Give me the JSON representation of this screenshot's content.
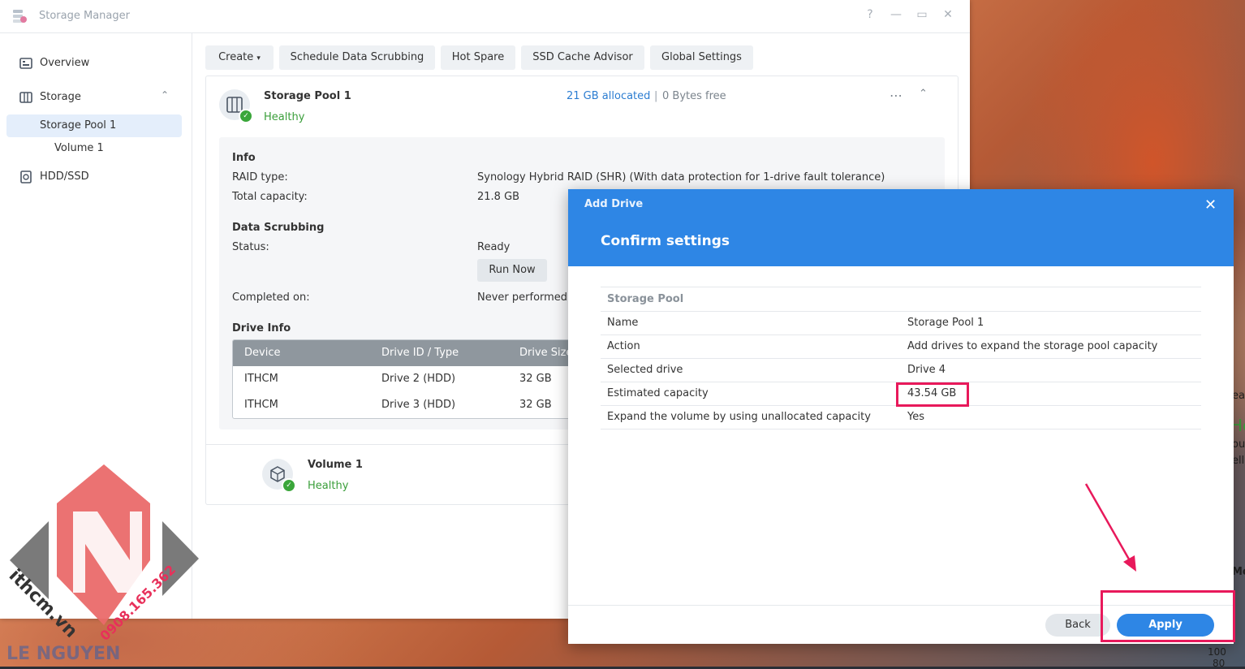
{
  "window": {
    "title": "Storage Manager",
    "controls": [
      "?",
      "—",
      "▭",
      "✕"
    ]
  },
  "sidebar": {
    "items": [
      {
        "label": "Overview",
        "icon": "overview-icon"
      },
      {
        "label": "Storage",
        "icon": "storage-icon"
      },
      {
        "label": "Storage Pool 1"
      },
      {
        "label": "Volume 1"
      },
      {
        "label": "HDD/SSD",
        "icon": "hdd-icon"
      }
    ]
  },
  "toolbar": {
    "create": "Create",
    "scrubbing": "Schedule Data Scrubbing",
    "hot_spare": "Hot Spare",
    "ssd_cache": "SSD Cache Advisor",
    "global_settings": "Global Settings"
  },
  "pool": {
    "name": "Storage Pool 1",
    "status": "Healthy",
    "allocated": "21 GB allocated",
    "separator": "|",
    "free": "0 Bytes free",
    "info_title": "Info",
    "raid_label": "RAID type:",
    "raid_value": "Synology Hybrid RAID (SHR) (With data protection for 1-drive fault tolerance)",
    "capacity_label": "Total capacity:",
    "capacity_value": "21.8 GB",
    "scrub_title": "Data Scrubbing",
    "scrub_status_label": "Status:",
    "scrub_status_value": "Ready",
    "run_now": "Run Now",
    "completed_label": "Completed on:",
    "completed_value": "Never performed",
    "drive_info_title": "Drive Info",
    "drive_table": {
      "headers": [
        "Device",
        "Drive ID / Type",
        "Drive Size"
      ],
      "rows": [
        [
          "ITHCM",
          "Drive 2 (HDD)",
          "32 GB"
        ],
        [
          "ITHCM",
          "Drive 3 (HDD)",
          "32 GB"
        ]
      ]
    }
  },
  "volume": {
    "name": "Volume 1",
    "status": "Healthy"
  },
  "modal": {
    "title": "Add Drive",
    "subtitle": "Confirm settings",
    "close": "✕",
    "section": "Storage Pool",
    "rows": [
      {
        "key": "Name",
        "value": "Storage Pool 1"
      },
      {
        "key": "Action",
        "value": "Add drives to expand the storage pool capacity"
      },
      {
        "key": "Selected drive",
        "value": "Drive 4"
      },
      {
        "key": "Estimated capacity",
        "value": "43.54 GB"
      },
      {
        "key": "Expand the volume by using unallocated capacity",
        "value": "Yes"
      }
    ],
    "back": "Back",
    "apply": "Apply"
  },
  "background_fragments": {
    "ea": "ea",
    "he": "He",
    "ou": "ou",
    "ell": "ell",
    "mo": "Mo",
    "n100": "100",
    "n80": "80"
  },
  "colors": {
    "accent": "#2e86e5",
    "healthy": "#3a9e3a",
    "highlight": "#e8195b"
  }
}
